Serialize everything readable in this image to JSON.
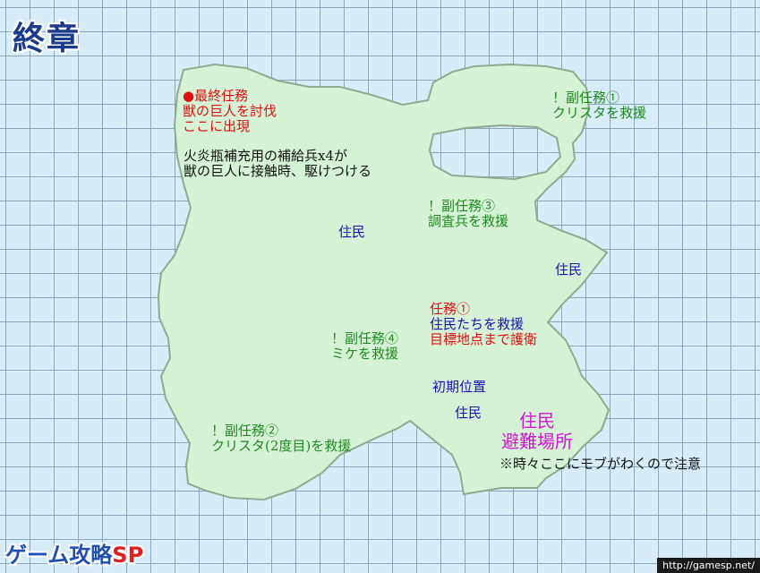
{
  "title": "終章",
  "colors": {
    "land": "#d6f2d6",
    "land_border": "#8faa8f",
    "water": "#d7ecf7",
    "grid": "#8aa6b8",
    "side_mission": "#1f8a1f",
    "main_mission": "#e01010",
    "residents": "#1414b4",
    "shelter": "#d414d4"
  },
  "labels": {
    "final_mission": {
      "line1": "●最終任務",
      "line2": "獣の巨人を討伐",
      "line3": "ここに出現"
    },
    "supply_note": {
      "line1": "火炎瓶補充用の補給兵x4が",
      "line2": "獣の巨人に接触時、駆けつける"
    },
    "side_mission_1": {
      "line1": "！副任務①",
      "line2": "クリスタを救援"
    },
    "side_mission_3": {
      "line1": "！副任務③",
      "line2": "調査兵を救援"
    },
    "side_mission_4": {
      "line1": "！副任務④",
      "line2": "ミケを救援"
    },
    "side_mission_2": {
      "line1": "！副任務②",
      "line2": "クリスタ(2度目)を救援"
    },
    "mission_1": {
      "line1": "任務①",
      "line2": "住民たちを救援",
      "line3": "目標地点まで護衛"
    },
    "resident_1": "住民",
    "resident_2": "住民",
    "resident_3": "住民",
    "start_position": "初期位置",
    "shelter": {
      "line1": "住民",
      "line2": "避難場所"
    },
    "mob_note": "※時々ここにモブがわくので注意"
  },
  "logo": {
    "main": "ゲーム攻略",
    "accent": "SP"
  },
  "url": "http://gamesp.net/"
}
